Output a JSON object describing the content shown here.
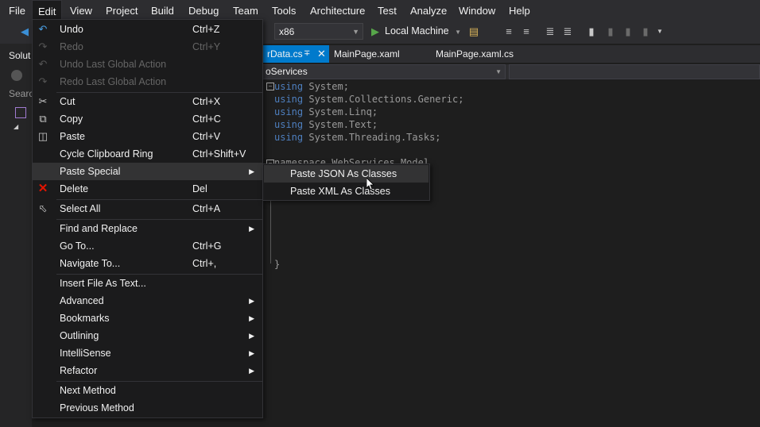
{
  "menubar": [
    "File",
    "Edit",
    "View",
    "Project",
    "Build",
    "Debug",
    "Team",
    "Tools",
    "Architecture",
    "Test",
    "Analyze",
    "Window",
    "Help"
  ],
  "toolbar": {
    "platform": "x86",
    "run_target": "Local Machine"
  },
  "left_panel": {
    "solution_label": "Solut",
    "search_label": "Searc"
  },
  "tabs": [
    {
      "label": "rData.cs",
      "active": true
    },
    {
      "label": "MainPage.xaml",
      "active": false
    },
    {
      "label": "MainPage.xaml.cs",
      "active": false
    }
  ],
  "navbar": {
    "scope": "oServices"
  },
  "code": {
    "lines": [
      {
        "kw": "using",
        "rest": " System;"
      },
      {
        "kw": "using",
        "rest": " System.Collections.Generic;"
      },
      {
        "kw": "using",
        "rest": " System.Linq;"
      },
      {
        "kw": "using",
        "rest": " System.Text;"
      },
      {
        "kw": "using",
        "rest": " System.Threading.Tasks;"
      }
    ],
    "namespace_line": "namespace WebServices.Model",
    "closing_brace": "}"
  },
  "edit_menu": {
    "items": [
      {
        "label": "Undo",
        "shortcut": "Ctrl+Z",
        "icon": "undo-icon"
      },
      {
        "label": "Redo",
        "shortcut": "Ctrl+Y",
        "icon": "redo-icon",
        "disabled": true
      },
      {
        "label": "Undo Last Global Action",
        "icon": "undo-global-icon",
        "disabled": true
      },
      {
        "label": "Redo Last Global Action",
        "icon": "redo-global-icon",
        "disabled": true
      },
      {
        "label": "Cut",
        "shortcut": "Ctrl+X",
        "icon": "cut-icon"
      },
      {
        "label": "Copy",
        "shortcut": "Ctrl+C",
        "icon": "copy-icon"
      },
      {
        "label": "Paste",
        "shortcut": "Ctrl+V",
        "icon": "paste-icon"
      },
      {
        "label": "Cycle Clipboard Ring",
        "shortcut": "Ctrl+Shift+V"
      },
      {
        "label": "Paste Special",
        "submenu": true,
        "highlighted": true
      },
      {
        "label": "Delete",
        "shortcut": "Del",
        "icon": "delete-icon"
      },
      {
        "label": "Select All",
        "shortcut": "Ctrl+A",
        "icon": "select-all-icon"
      },
      {
        "label": "Find and Replace",
        "submenu": true
      },
      {
        "label": "Go To...",
        "shortcut": "Ctrl+G"
      },
      {
        "label": "Navigate To...",
        "shortcut": "Ctrl+,"
      },
      {
        "label": "Insert File As Text..."
      },
      {
        "label": "Advanced",
        "submenu": true
      },
      {
        "label": "Bookmarks",
        "submenu": true
      },
      {
        "label": "Outlining",
        "submenu": true
      },
      {
        "label": "IntelliSense",
        "submenu": true
      },
      {
        "label": "Refactor",
        "submenu": true
      },
      {
        "label": "Next Method"
      },
      {
        "label": "Previous Method"
      }
    ]
  },
  "paste_special_menu": {
    "items": [
      {
        "label": "Paste JSON As Classes",
        "highlighted": true
      },
      {
        "label": "Paste XML As Classes"
      }
    ]
  },
  "colors": {
    "accent": "#007acc",
    "delete_icon": "#e51400",
    "keyword": "#569cd6"
  }
}
